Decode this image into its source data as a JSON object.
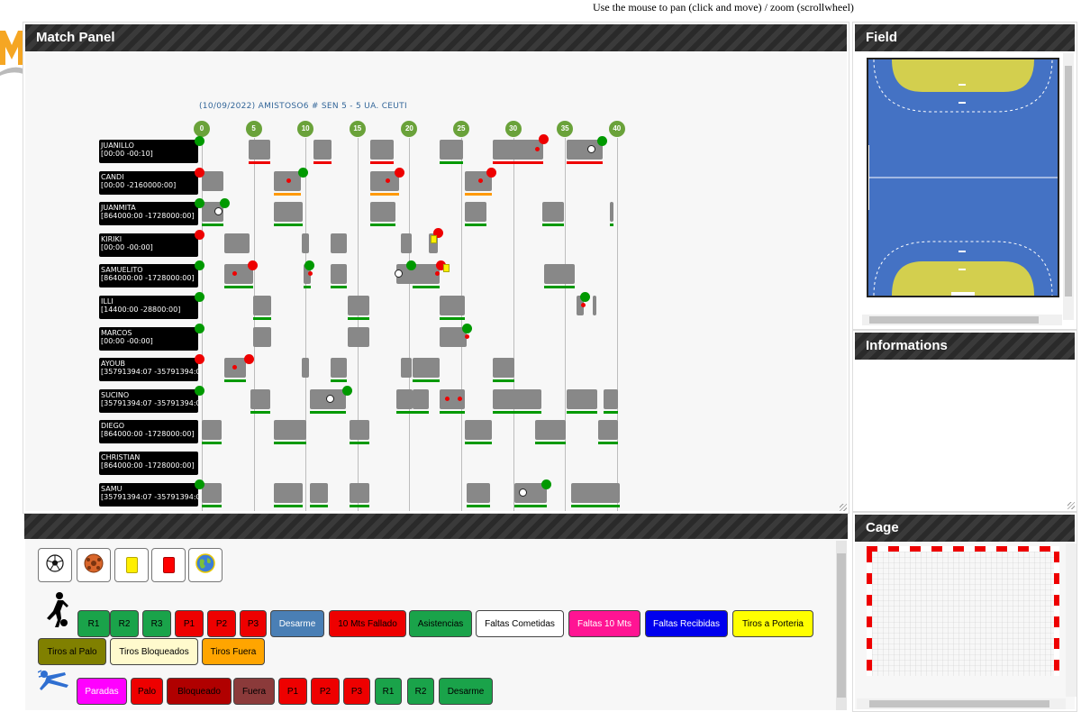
{
  "hint": "Use the mouse to pan (click and move) / zoom (scrollwheel)",
  "panels": {
    "match": "Match Panel",
    "field": "Field",
    "informations": "Informations",
    "cage": "Cage"
  },
  "timeline": {
    "title": "(10/09/2022) AMISTOSO6 # SEN 5 - 5 UA. CEUTI",
    "ticks": [
      "0",
      "5",
      "10",
      "15",
      "20",
      "25",
      "30",
      "35",
      "40"
    ]
  },
  "players": [
    {
      "name": "JUANILLO",
      "time": "[00:00 -00:10]"
    },
    {
      "name": "CANDI",
      "time": "[00:00 -2160000:00]"
    },
    {
      "name": "JUANMITA",
      "time": "[864000:00 -1728000:00]"
    },
    {
      "name": "KIRIKI",
      "time": "[00:00 -00:00]"
    },
    {
      "name": "SAMUELITO",
      "time": "[864000:00 -1728000:00]"
    },
    {
      "name": "ILLI",
      "time": "[14400:00 -28800:00]"
    },
    {
      "name": "MARCOS",
      "time": "[00:00 -00:00]"
    },
    {
      "name": "AYOUB",
      "time": "[35791394:07 -35791394:07]"
    },
    {
      "name": "SUCINO",
      "time": "[35791394:07 -35791394:07]"
    },
    {
      "name": "DIEGO",
      "time": "[864000:00 -1728000:00]"
    },
    {
      "name": "CHRISTIAN",
      "time": "[864000:00 -1728000:00]"
    },
    {
      "name": "SAMU",
      "time": "[35791394:07 -35791394:07]"
    }
  ],
  "player_actions": [
    "R1",
    "R2",
    "R3",
    "P1",
    "P2",
    "P3",
    "Desarme",
    "10 Mts Fallado",
    "Asistencias",
    "Faltas Cometidas",
    "Faltas 10 Mts",
    "Faltas Recibidas",
    "Tiros a Porteria",
    "Tiros al Palo",
    "Tiros Bloqueados",
    "Tiros Fuera"
  ],
  "keeper_actions": [
    "Paradas",
    "Palo",
    "Bloqueado",
    "Fuera",
    "P1",
    "P2",
    "P3",
    "R1",
    "R2",
    "Desarme"
  ],
  "icons": [
    "football-icon",
    "futsal-ball-icon",
    "yellow-card-icon",
    "red-card-icon",
    "globe-icon",
    "player-kick-icon",
    "goalkeeper-dive-icon"
  ],
  "colors": {
    "field_blue": "#4472c4",
    "goal_area": "#d3cf4e",
    "tick_green": "#6aa23a",
    "header_dark": "#2d2d2d"
  }
}
